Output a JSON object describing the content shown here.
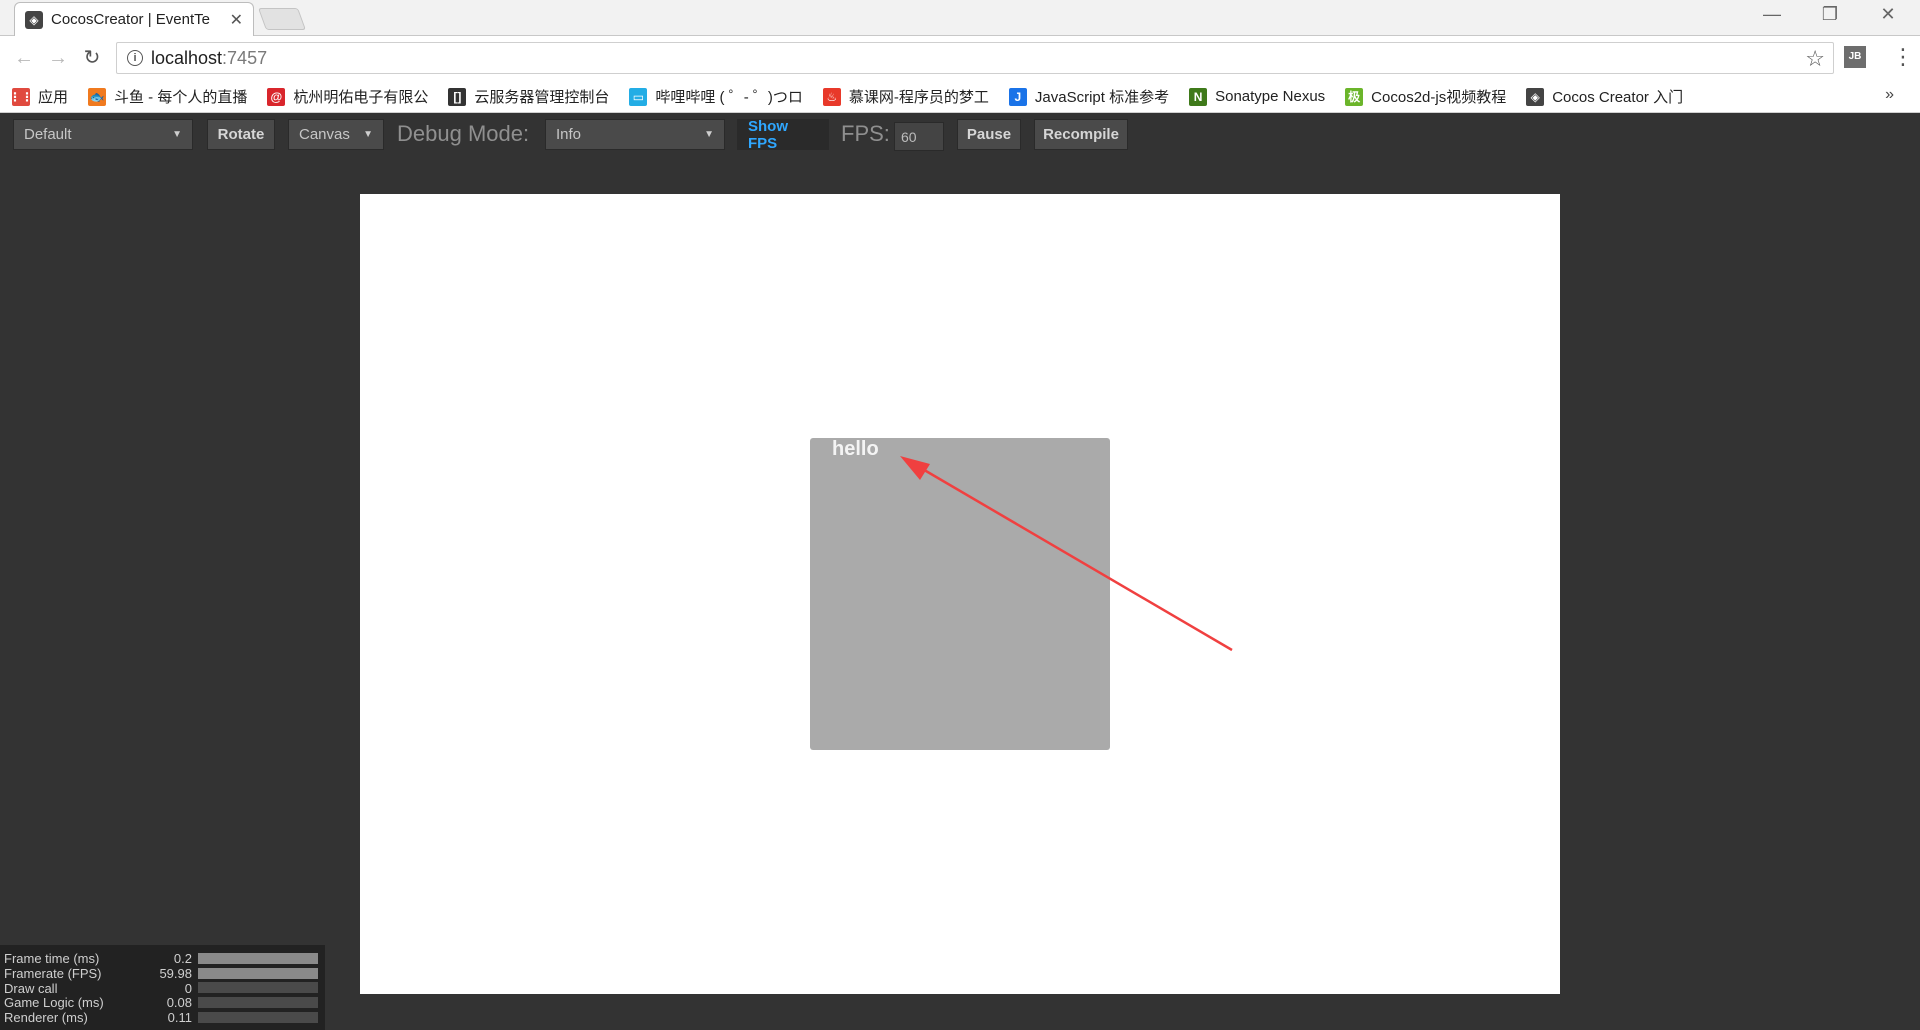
{
  "browser": {
    "tab_title": "CocosCreator | EventTe",
    "url_host": "localhost",
    "url_port": ":7457",
    "bookmarks": [
      {
        "label": "应用",
        "icon": "apps-grid-icon",
        "color": "#e04a3f"
      },
      {
        "label": "斗鱼 - 每个人的直播",
        "icon": "douyu-icon",
        "color": "#f07a1f"
      },
      {
        "label": "杭州明佑电子有限公",
        "icon": "at-icon",
        "color": "#d9262c"
      },
      {
        "label": "云服务器管理控制台",
        "icon": "cloud-icon",
        "color": "#333333"
      },
      {
        "label": "哔哩哔哩 ( ゜- ゜)つロ",
        "icon": "bilibili-icon",
        "color": "#23ade5"
      },
      {
        "label": "慕课网-程序员的梦工",
        "icon": "fire-icon",
        "color": "#e8392a"
      },
      {
        "label": "JavaScript 标准参考",
        "icon": "j-icon",
        "color": "#1a73e8"
      },
      {
        "label": "Sonatype Nexus",
        "icon": "n-icon",
        "color": "#3f7a1a"
      },
      {
        "label": "Cocos2d-js视频教程",
        "icon": "book-icon",
        "color": "#6bb52a"
      },
      {
        "label": "Cocos Creator 入门",
        "icon": "cocos-icon",
        "color": "#444444"
      }
    ]
  },
  "toolbar": {
    "device_select": "Default",
    "rotate_label": "Rotate",
    "render_select": "Canvas",
    "debug_mode_label": "Debug Mode:",
    "debug_mode_select": "Info",
    "show_fps_label": "Show FPS",
    "fps_label": "FPS:",
    "fps_value": "60",
    "pause_label": "Pause",
    "recompile_label": "Recompile"
  },
  "scene": {
    "node_text": "hello"
  },
  "stats": [
    {
      "label": "Frame time (ms)",
      "value": "0.2",
      "fill": 1.0
    },
    {
      "label": "Framerate (FPS)",
      "value": "59.98",
      "fill": 1.0
    },
    {
      "label": "Draw call",
      "value": "0",
      "fill": 0
    },
    {
      "label": "Game Logic (ms)",
      "value": "0.08",
      "fill": 0
    },
    {
      "label": "Renderer (ms)",
      "value": "0.11",
      "fill": 0
    }
  ],
  "colors": {
    "accent": "#2fa7ff",
    "arrow": "#f04040",
    "node": "#aaaaaa"
  }
}
